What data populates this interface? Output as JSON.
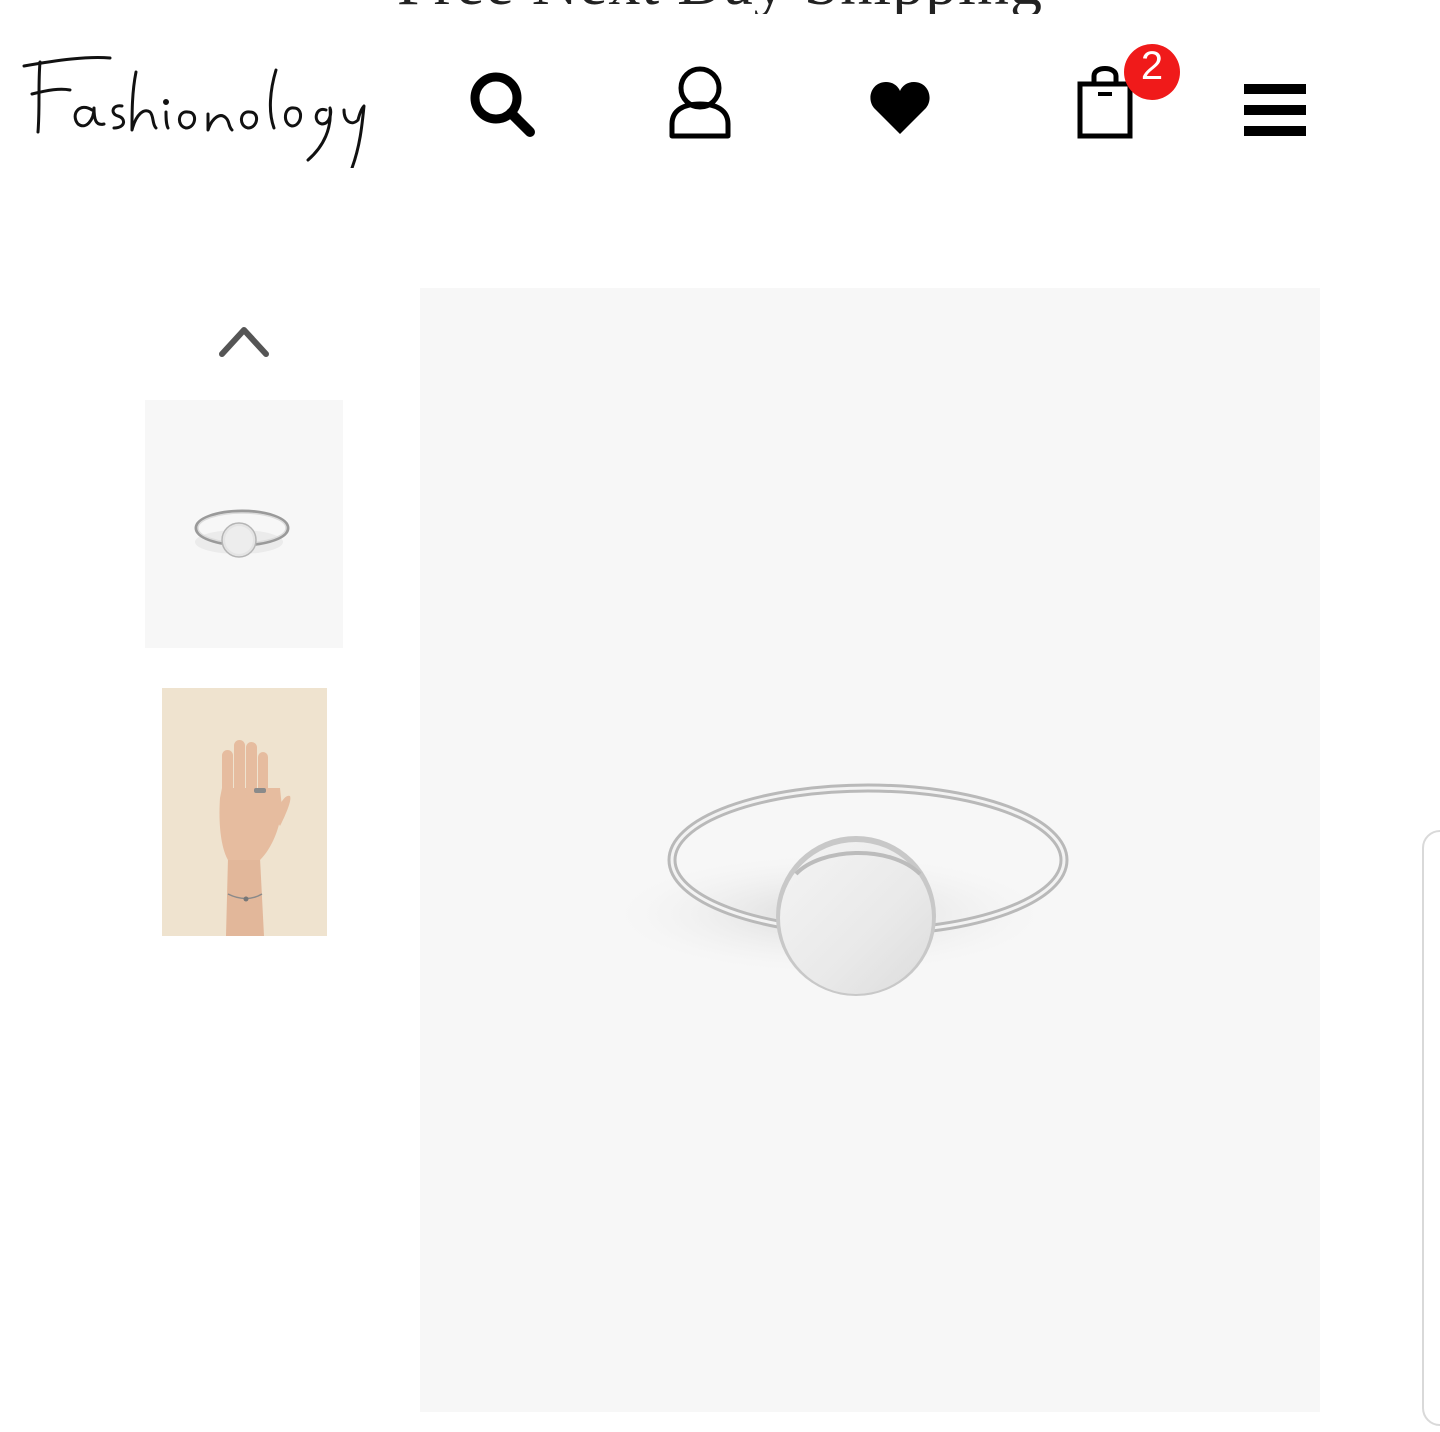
{
  "promo": {
    "text": "Free Next Day Shipping"
  },
  "header": {
    "logo_text": "Fashionology",
    "cart_count": "2",
    "icons": [
      "search-icon",
      "user-icon",
      "heart-icon",
      "shopping-bag-icon",
      "hamburger-menu-icon"
    ]
  },
  "gallery": {
    "thumbnails": [
      {
        "name": "ring-product-thumb"
      },
      {
        "name": "ring-on-hand-thumb"
      }
    ]
  },
  "colors": {
    "badge": "#f01a1a",
    "image_bg": "#f7f7f7",
    "thumb2_bg": "#efe3cf"
  }
}
